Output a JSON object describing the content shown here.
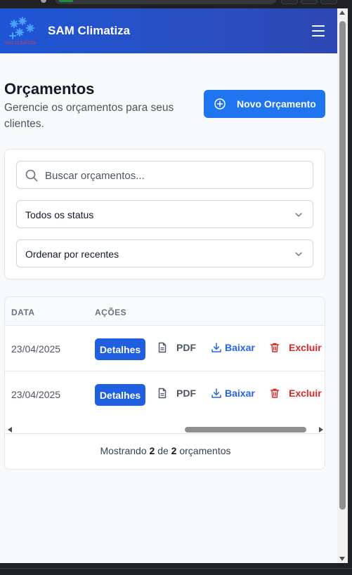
{
  "header": {
    "brand": "SAM Climatiza",
    "logo_text": "SAM CLIMATIZA",
    "icons": {
      "logo": "snowflake-logo-icon",
      "menu": "hamburger-menu-icon"
    },
    "color": "#1e55d6"
  },
  "page": {
    "title": "Orçamentos",
    "subtitle": "Gerencie os orçamentos para seus clientes.",
    "new_button": "Novo Orçamento",
    "new_button_icon": "plus-circle-icon",
    "accent": "#1f74f0"
  },
  "filters": {
    "search_placeholder": "Buscar orçamentos...",
    "status_value": "Todos os status",
    "sort_value": "Ordenar por recentes"
  },
  "table": {
    "columns": [
      "DATA",
      "AÇÕES"
    ],
    "rows": [
      {
        "date": "23/04/2025",
        "details": "Detalhes",
        "pdf": "PDF",
        "download": "Baixar",
        "delete": "Excluir"
      },
      {
        "date": "23/04/2025",
        "details": "Detalhes",
        "pdf": "PDF",
        "download": "Baixar",
        "delete": "Excluir"
      }
    ],
    "footer": {
      "prefix": "Mostrando",
      "shown": "2",
      "middle": "de",
      "total": "2",
      "suffix": "orçamentos"
    },
    "colors": {
      "details": "#1f5fe0",
      "download": "#2563eb",
      "delete": "#dc2626"
    }
  }
}
